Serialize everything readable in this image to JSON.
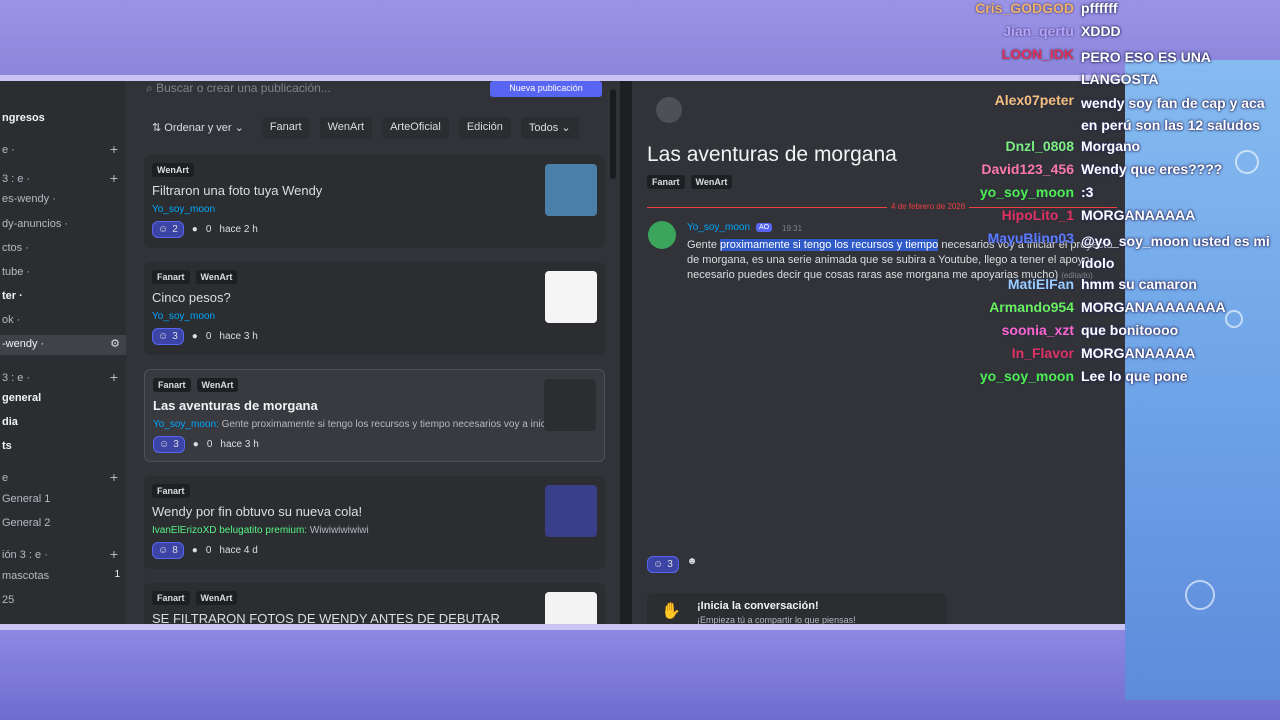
{
  "sidebar": {
    "items": [
      {
        "label": "ngresos",
        "style": "bold",
        "plus": false
      },
      {
        "label": "e ·",
        "style": "",
        "plus": true
      },
      {
        "label": "3 : e ·",
        "style": "",
        "plus": true
      },
      {
        "label": "es-wendy ·",
        "style": "",
        "plus": false
      },
      {
        "label": "dy-anuncios ·",
        "style": "",
        "plus": false
      },
      {
        "label": "ctos ·",
        "style": "",
        "plus": false
      },
      {
        "label": "tube ·",
        "style": "",
        "plus": false
      },
      {
        "label": "ter ·",
        "style": "bold",
        "plus": false
      },
      {
        "label": "ok ·",
        "style": "",
        "plus": false
      },
      {
        "label": "-wendy ·",
        "style": "active",
        "plus": false
      },
      {
        "label": "3 : e ·",
        "style": "",
        "plus": true
      },
      {
        "label": "general",
        "style": "bold",
        "plus": false
      },
      {
        "label": "dia",
        "style": "bold",
        "plus": false
      },
      {
        "label": "ts",
        "style": "bold",
        "plus": false
      },
      {
        "label": "e",
        "style": "",
        "plus": true
      },
      {
        "label": "General 1",
        "style": "",
        "plus": false
      },
      {
        "label": "General 2",
        "style": "",
        "plus": false
      },
      {
        "label": "ión 3 : e ·",
        "style": "",
        "plus": true
      },
      {
        "label": "mascotas",
        "style": "",
        "plus": false,
        "count": "1"
      },
      {
        "label": "25",
        "style": "",
        "plus": false
      }
    ]
  },
  "forum": {
    "search_placeholder": "Buscar o crear una publicación...",
    "new_post_label": "Nueva publicación",
    "sort_label": "Ordenar y ver",
    "filters": [
      "Fanart",
      "WenArt",
      "ArteOficial",
      "Edición"
    ],
    "all_label": "Todos",
    "posts": [
      {
        "tags": [
          "WenArt"
        ],
        "title": "Filtraron una foto tuya Wendy",
        "author": "Yo_soy_moon",
        "preview": "",
        "reactions": "2",
        "comments": "0",
        "time": "hace 2 h",
        "thumb_color": "#4a7fa8"
      },
      {
        "tags": [
          "Fanart",
          "WenArt"
        ],
        "title": "Cinco pesos?",
        "author": "Yo_soy_moon",
        "preview": "",
        "reactions": "3",
        "comments": "0",
        "time": "hace 3 h",
        "thumb_color": "#f5f5f5"
      },
      {
        "tags": [
          "Fanart",
          "WenArt"
        ],
        "title": "Las aventuras de morgana",
        "author": "Yo_soy_moon:",
        "preview": "Gente proximamente si tengo los recursos y tiempo necesarios voy a inici...",
        "reactions": "3",
        "comments": "0",
        "time": "hace 3 h",
        "thumb_color": "#2b2d31"
      },
      {
        "tags": [
          "Fanart"
        ],
        "title": "Wendy por fin obtuvo su nueva cola!",
        "author": "IvanElErizoXD belugatito premium:",
        "preview": "Wiwiwiwiwiwi",
        "reactions": "8",
        "comments": "0",
        "time": "hace 4 d",
        "thumb_color": "#3a3f8a"
      },
      {
        "tags": [
          "Fanart",
          "WenArt"
        ],
        "title": "SE FILTRARON FOTOS DE WENDY ANTES DE DEBUTAR",
        "author": "",
        "preview": "",
        "reactions": "",
        "comments": "",
        "time": "",
        "thumb_color": "#f3f3f3"
      }
    ]
  },
  "thread": {
    "title": "Las aventuras de morgana",
    "tags": [
      "Fanart",
      "WenArt"
    ],
    "date": "4 de febrero de 2026",
    "author": "Yo_soy_moon",
    "badge": "AO",
    "time": "19:31",
    "message_pre": "Gente ",
    "message_highlight": "proximamente si tengo los recursos y tiempo",
    "message_post": " necesarios voy a iniciar el proyecto de morgana, es una serie animada que se subira a Youtube, llego a tener el apoyo necesario puedes decir que cosas raras ase morgana me apoyarias mucho)",
    "edited": "(editado)",
    "reactions": "3",
    "convo_title": "¡Inicia la conversación!",
    "convo_sub": "¡Empieza tú a compartir lo que piensas!"
  },
  "chat": [
    {
      "user": "Cris_GODGOD",
      "msg": "pffffff",
      "color": "#f0b26a"
    },
    {
      "user": "Jian_qertu",
      "msg": "XDDD",
      "color": "#b9a4ff"
    },
    {
      "user": "LOON_IDK",
      "msg": "PERO ESO ES UNA LANGOSTA",
      "color": "#e0325a"
    },
    {
      "user": "Alex07peter",
      "msg": "wendy soy fan de cap y aca en perú son las 12 saludos",
      "color": "#f5c07a"
    },
    {
      "user": "Dnzl_0808",
      "msg": "Morgano",
      "color": "#7cf07c"
    },
    {
      "user": "David123_456",
      "msg": "Wendy que eres????",
      "color": "#ff7aa0"
    },
    {
      "user": "yo_soy_moon",
      "msg": ":3",
      "color": "#4df04d"
    },
    {
      "user": "HipoLito_1",
      "msg": "MORGANAAAAA",
      "color": "#e0325a"
    },
    {
      "user": "MayuBlinn03",
      "msg": "@yo_soy_moon usted es mi idolo",
      "color": "#5a7cff"
    },
    {
      "user": "MatiElFan",
      "msg": "hmm su camaron",
      "color": "#9ad0ff"
    },
    {
      "user": "Armando954",
      "msg": "MORGANAAAAAAAA",
      "color": "#6af05a"
    },
    {
      "user": "soonia_xzt",
      "msg": "que bonitoooo",
      "color": "#ff66cc"
    },
    {
      "user": "In_Flavor",
      "msg": "MORGANAAAAA",
      "color": "#e0325a"
    },
    {
      "user": "yo_soy_moon",
      "msg": "Lee lo que pone",
      "color": "#4df04d"
    }
  ]
}
